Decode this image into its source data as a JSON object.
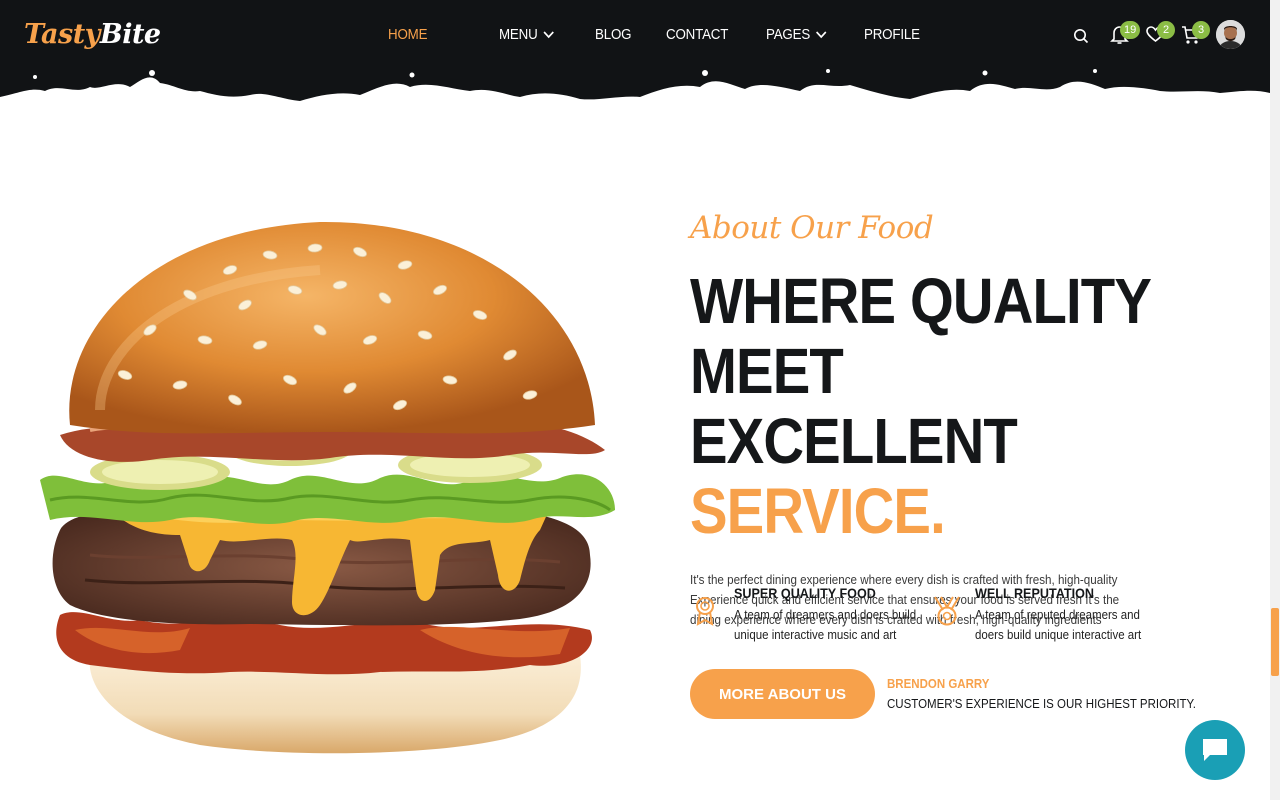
{
  "header": {
    "logo_part1": "Tasty",
    "logo_part2": "Bite",
    "nav": [
      {
        "label": "HOME",
        "active": true,
        "dropdown": false
      },
      {
        "label": "MENU",
        "active": false,
        "dropdown": true
      },
      {
        "label": "BLOG",
        "active": false,
        "dropdown": false
      },
      {
        "label": "CONTACT",
        "active": false,
        "dropdown": false
      },
      {
        "label": "PAGES",
        "active": false,
        "dropdown": true
      },
      {
        "label": "PROFILE",
        "active": false,
        "dropdown": false
      }
    ],
    "icons": {
      "search": "search-icon",
      "notifications": {
        "icon": "bell-icon",
        "count": "19"
      },
      "wishlist": {
        "icon": "heart-icon",
        "count": "2"
      },
      "cart": {
        "icon": "cart-icon",
        "count": "3"
      }
    }
  },
  "hero": {
    "subtitle": "About Our Food",
    "headline_line1": "WHERE QUALITY",
    "headline_line2": "MEET EXCELLENT",
    "headline_accent": "SERVICE.",
    "description": "It's the perfect dining experience where every dish is crafted with fresh, high-quality Experience quick and efficient service that ensures your food is served fresh It's the dining experience where every dish is crafted with fresh, high-quality ingredients",
    "features": [
      {
        "icon": "award-ribbon-icon",
        "title": "SUPER QUALITY FOOD",
        "text": "A team of dreamers and doers build unique interactive music and art"
      },
      {
        "icon": "medal-icon",
        "title": "WELL REPUTATION",
        "text": "A team of reputed dreamers and doers build unique interactive art"
      }
    ],
    "cta_label": "MORE ABOUT US",
    "signature_name": "BRENDON GARRY",
    "signature_text": "CUSTOMER'S EXPERIENCE IS OUR HIGHEST PRIORITY."
  },
  "colors": {
    "accent": "#f7a14b",
    "dark": "#111315",
    "badge": "#8bbd45",
    "chat": "#1a9fb5"
  }
}
